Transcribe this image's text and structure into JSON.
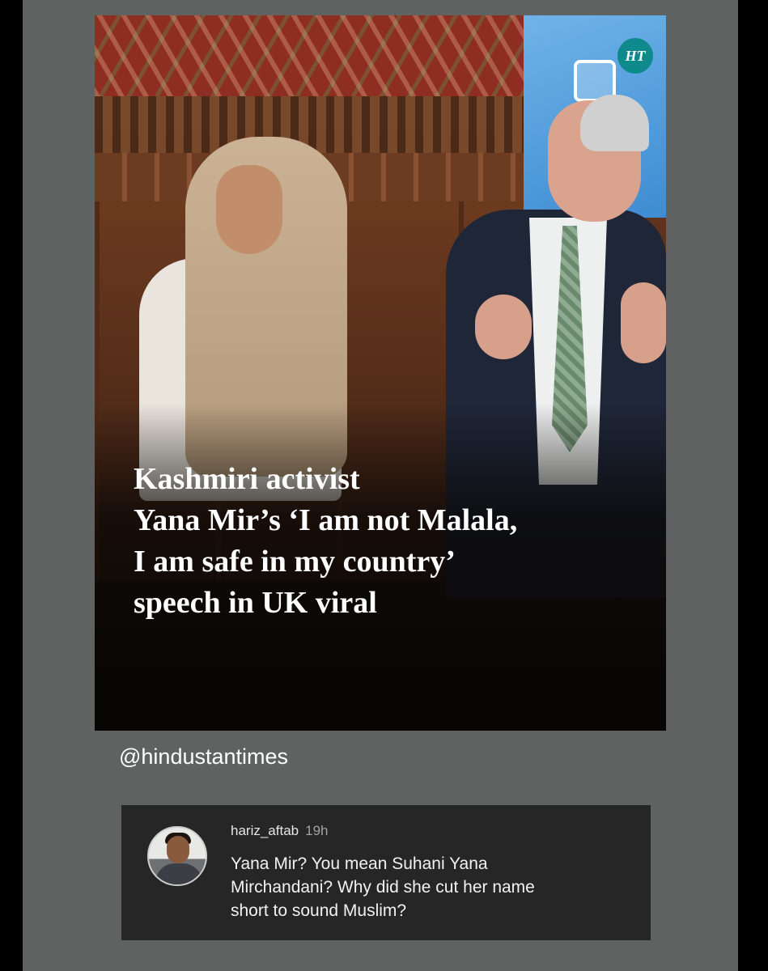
{
  "post": {
    "logo_text": "HT",
    "headline_lines": [
      "Kashmiri activist",
      "Yana Mir’s ‘I am not Malala,",
      "I am safe in my country’",
      "speech in UK viral"
    ],
    "handle": "@hindustantimes"
  },
  "comment": {
    "username": "hariz_aftab",
    "time": "19h",
    "text_lines": [
      "Yana Mir? You mean Suhani Yana",
      "Mirchandani? Why did she cut her name",
      "short to sound Muslim?"
    ]
  },
  "colors": {
    "page_bg": "#5f6261",
    "comment_bg": "#262626",
    "logo_bg": "#0e8a8d"
  }
}
